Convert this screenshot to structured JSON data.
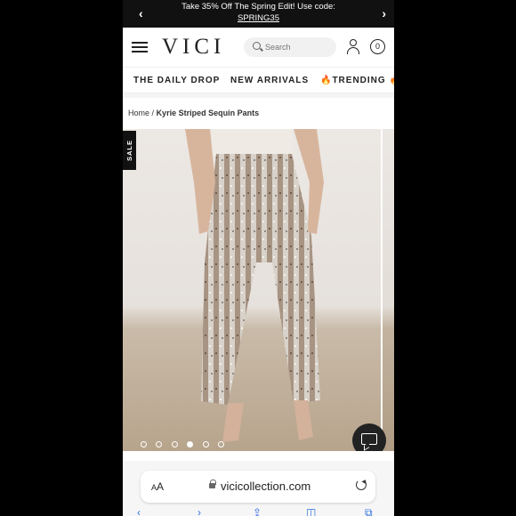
{
  "promo": {
    "prev_icon": "chevron-left-icon",
    "line1": "Take 35% Off The Spring Edit! Use code:",
    "code": "SPRING35",
    "next_icon": "chevron-right-icon"
  },
  "header": {
    "menu_icon": "hamburger-menu-icon",
    "logo": "VICI",
    "search_placeholder": "Search",
    "account_icon": "user-icon",
    "cart_count": "0"
  },
  "nav": {
    "items": [
      "THE DAILY DROP",
      "NEW ARRIVALS",
      "🔥TRENDING 🔥"
    ]
  },
  "breadcrumb": {
    "home": "Home",
    "separator": "/",
    "current": "Kyrie Striped Sequin Pants"
  },
  "gallery": {
    "badge": "SALE",
    "image_count": 6,
    "active_index": 3,
    "chat_icon": "chat-bubble-icon"
  },
  "browser": {
    "aa_label": "AA",
    "lock_icon": "lock-icon",
    "url": "vicicollection.com",
    "reload_icon": "reload-icon",
    "toolbar_icons": [
      "back-icon",
      "forward-icon",
      "share-icon",
      "bookmarks-icon",
      "tabs-icon"
    ]
  },
  "colors": {
    "promo_bg": "#111111",
    "accent_blue": "#2f6fe0",
    "sequin_silver": "#c9c2ba",
    "sequin_rose": "#b59a86"
  }
}
